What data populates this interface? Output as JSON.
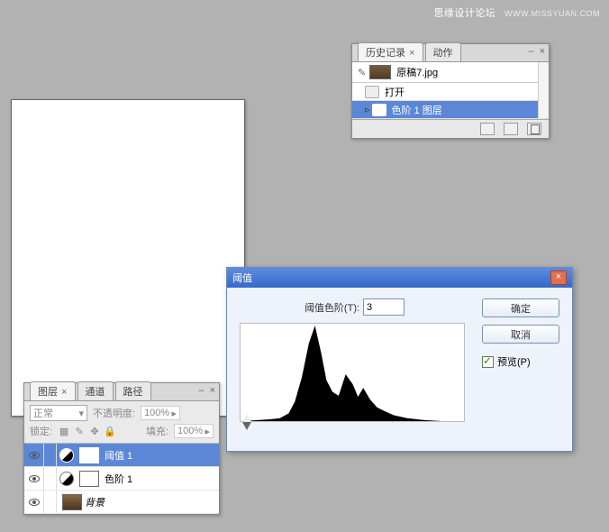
{
  "watermark": {
    "main": "思缘设计论坛",
    "sub": "WWW.MISSYUAN.COM"
  },
  "history_panel": {
    "tabs": {
      "history": "历史记录",
      "actions": "动作"
    },
    "doc_name": "原稿7.jpg",
    "rows": {
      "open": "打开",
      "levels_layer": "色阶 1 图层"
    }
  },
  "dialog": {
    "title": "阈值",
    "level_label": "阈值色阶(T):",
    "level_value": "3",
    "ok": "确定",
    "cancel": "取消",
    "preview": "预览(P)"
  },
  "layers_panel": {
    "tabs": {
      "layers": "图层",
      "channels": "通道",
      "paths": "路径"
    },
    "blend_mode": "正常",
    "opacity_label": "不透明度:",
    "opacity_value": "100%",
    "lock_label": "锁定:",
    "fill_label": "填充:",
    "fill_value": "100%",
    "rows": {
      "threshold1": "阈值 1",
      "levels1": "色阶 1",
      "background": "背景"
    }
  },
  "chart_data": {
    "type": "area",
    "title": "阈值",
    "xlabel": "",
    "ylabel": "",
    "xlim": [
      0,
      255
    ],
    "ylim": [
      0,
      100
    ],
    "x": [
      0,
      20,
      35,
      45,
      55,
      62,
      70,
      78,
      85,
      92,
      98,
      105,
      112,
      120,
      128,
      134,
      140,
      148,
      156,
      165,
      175,
      190,
      210,
      230,
      255
    ],
    "values": [
      0,
      1,
      2,
      3,
      8,
      20,
      45,
      80,
      98,
      70,
      42,
      30,
      26,
      48,
      38,
      25,
      34,
      22,
      14,
      10,
      6,
      3,
      1,
      0,
      0
    ]
  }
}
